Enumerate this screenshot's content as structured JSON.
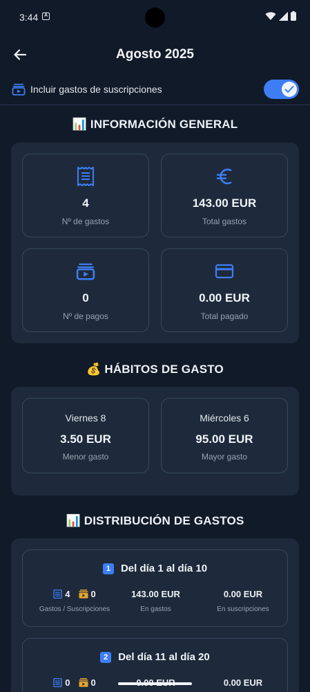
{
  "status": {
    "time": "3:44",
    "a_glyph": "A"
  },
  "header": {
    "title": "Agosto 2025",
    "back_icon": "arrow-left-icon"
  },
  "subscriptions_toggle": {
    "label": "Incluir gastos de suscripciones",
    "on": true
  },
  "colors": {
    "accent": "#3d7ef5",
    "background": "#111a28",
    "card": "#1e2a3b",
    "coin": "#e5a52f"
  },
  "general": {
    "title": "📊 INFORMACIÓN GENERAL",
    "cards": [
      {
        "icon": "receipt-icon",
        "value": "4",
        "label": "Nº de gastos"
      },
      {
        "icon": "euro-icon",
        "value": "143.00 EUR",
        "label": "Total gastos"
      },
      {
        "icon": "subscriptions-icon",
        "value": "0",
        "label": "Nº de pagos"
      },
      {
        "icon": "credit-card-icon",
        "value": "0.00 EUR",
        "label": "Total pagado"
      }
    ]
  },
  "habits": {
    "title": "💰 HÁBITOS DE GASTO",
    "cards": [
      {
        "day": "Viernes 8",
        "value": "3.50 EUR",
        "label": "Menor gasto"
      },
      {
        "day": "Miércoles 6",
        "value": "95.00 EUR",
        "label": "Mayor gasto"
      }
    ]
  },
  "distribution": {
    "title": "📊 DISTRIBUCIÓN DE GASTOS",
    "ranges": [
      {
        "badge": "1",
        "title": "Del día 1 al día 10",
        "expenses_count": "4",
        "subs_count": "0",
        "counts_label": "Gastos / Suscripciones",
        "expenses_total": "143.00 EUR",
        "expenses_label": "En gastos",
        "subs_total": "0.00 EUR",
        "subs_label": "En suscripciones"
      },
      {
        "badge": "2",
        "title": "Del día 11 al día 20",
        "expenses_count": "0",
        "subs_count": "0",
        "expenses_total": "0.00 EUR",
        "subs_total": "0.00 EUR"
      }
    ]
  }
}
